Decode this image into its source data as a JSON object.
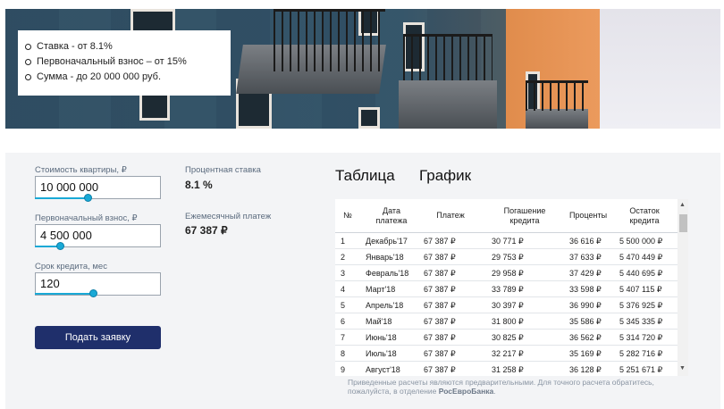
{
  "hero": {
    "bullets": [
      "Ставка - от 8.1%",
      "Первоначальный взнос – от 15%",
      "Сумма - до 20 000 000 руб."
    ]
  },
  "form": {
    "price_label": "Стоимость квартиры, ₽",
    "price_value": "10 000 000",
    "price_slider": 0.42,
    "down_label": "Первоначальный взнос, ₽",
    "down_value": "4 500 000",
    "down_slider": 0.2,
    "term_label": "Срок кредита, мес",
    "term_value": "120",
    "term_slider": 0.46,
    "submit_label": "Подать заявку"
  },
  "results": {
    "rate_label": "Процентная ставка",
    "rate_value": "8.1 %",
    "monthly_label": "Ежемесячный платеж",
    "monthly_value": "67 387 ₽"
  },
  "tabs": [
    {
      "label": "Таблица",
      "active": false
    },
    {
      "label": "График",
      "active": true
    }
  ],
  "table": {
    "headers": [
      "№",
      "Дата платежа",
      "Платеж",
      "Погашение кредита",
      "Проценты",
      "Остаток кредита"
    ],
    "rows": [
      [
        "1",
        "Декабрь'17",
        "67 387 ₽",
        "30 771 ₽",
        "36 616 ₽",
        "5 500 000 ₽"
      ],
      [
        "2",
        "Январь'18",
        "67 387 ₽",
        "29 753 ₽",
        "37 633 ₽",
        "5 470 449 ₽"
      ],
      [
        "3",
        "Февраль'18",
        "67 387 ₽",
        "29 958 ₽",
        "37 429 ₽",
        "5 440 695 ₽"
      ],
      [
        "4",
        "Март'18",
        "67 387 ₽",
        "33 789 ₽",
        "33 598 ₽",
        "5 407 115 ₽"
      ],
      [
        "5",
        "Апрель'18",
        "67 387 ₽",
        "30 397 ₽",
        "36 990 ₽",
        "5 376 925 ₽"
      ],
      [
        "6",
        "Май'18",
        "67 387 ₽",
        "31 800 ₽",
        "35 586 ₽",
        "5 345 335 ₽"
      ],
      [
        "7",
        "Июнь'18",
        "67 387 ₽",
        "30 825 ₽",
        "36 562 ₽",
        "5 314 720 ₽"
      ],
      [
        "8",
        "Июль'18",
        "67 387 ₽",
        "32 217 ₽",
        "35 169 ₽",
        "5 282 716 ₽"
      ],
      [
        "9",
        "Август'18",
        "67 387 ₽",
        "31 258 ₽",
        "36 128 ₽",
        "5 251 671 ₽"
      ]
    ]
  },
  "note": {
    "text": "Приведенные расчеты являются предварительными. Для точного расчета обратитесь, пожалуйста, в отделение ",
    "bank": "РосЕвроБанка",
    "end": "."
  },
  "colors": {
    "accent": "#19a9d6",
    "button": "#1f2f6b",
    "panel": "#f3f4f6"
  }
}
